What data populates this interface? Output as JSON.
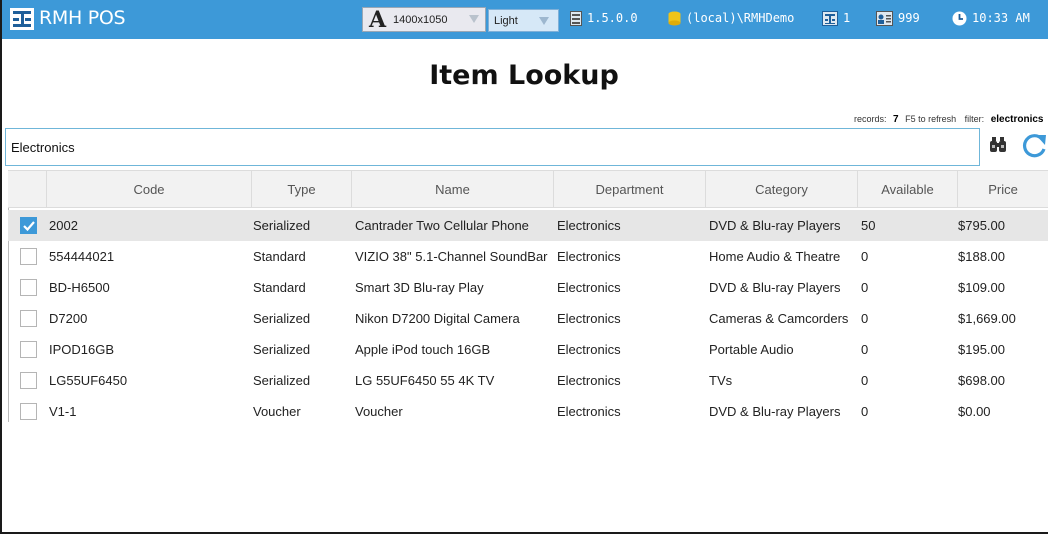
{
  "app": {
    "title": "RMH POS"
  },
  "toolbar": {
    "resolution": "1400x1050",
    "theme": "Light",
    "version": "1.5.0.0",
    "database": "(local)\\RMHDemo",
    "register": "1",
    "cashier": "999",
    "time": "10:33 AM"
  },
  "page": {
    "title": "Item Lookup"
  },
  "status": {
    "records_label": "records:",
    "records_count": "7",
    "refresh_hint": "F5 to refresh",
    "filter_label": "filter:",
    "filter_value": "electronics"
  },
  "search": {
    "value": "Electronics"
  },
  "table": {
    "columns": [
      "Code",
      "Type",
      "Name",
      "Department",
      "Category",
      "Available",
      "Price"
    ],
    "rows": [
      {
        "checked": true,
        "code": "2002",
        "type": "Serialized",
        "name": "Cantrader Two Cellular Phone",
        "department": "Electronics",
        "category": "DVD & Blu-ray Players",
        "available": "50",
        "price": "$795.00"
      },
      {
        "checked": false,
        "code": "554444021",
        "type": "Standard",
        "name": "VIZIO 38\" 5.1-Channel SoundBar",
        "department": "Electronics",
        "category": "Home Audio & Theatre",
        "available": "0",
        "price": "$188.00"
      },
      {
        "checked": false,
        "code": "BD-H6500",
        "type": "Standard",
        "name": "Smart 3D Blu-ray Play",
        "department": "Electronics",
        "category": "DVD & Blu-ray Players",
        "available": "0",
        "price": "$109.00"
      },
      {
        "checked": false,
        "code": "D7200",
        "type": "Serialized",
        "name": "Nikon D7200 Digital Camera",
        "department": "Electronics",
        "category": "Cameras & Camcorders",
        "available": "0",
        "price": "$1,669.00"
      },
      {
        "checked": false,
        "code": "IPOD16GB",
        "type": "Serialized",
        "name": "Apple iPod touch 16GB",
        "department": "Electronics",
        "category": "Portable Audio",
        "available": "0",
        "price": "$195.00"
      },
      {
        "checked": false,
        "code": "LG55UF6450",
        "type": "Serialized",
        "name": "LG 55UF6450 55 4K TV",
        "department": "Electronics",
        "category": "TVs",
        "available": "0",
        "price": "$698.00"
      },
      {
        "checked": false,
        "code": "V1-1",
        "type": "Voucher",
        "name": "Voucher",
        "department": "Electronics",
        "category": "DVD & Blu-ray Players",
        "available": "0",
        "price": "$0.00"
      }
    ]
  },
  "icons": {
    "logo": "rmh-logo-icon",
    "resolution": "font-size-icon",
    "version": "server-icon",
    "database": "database-icon",
    "register": "register-icon",
    "cashier": "cashier-icon",
    "clock": "clock-icon",
    "find": "binoculars-icon",
    "refresh": "refresh-icon",
    "check": "checkmark-icon"
  },
  "colors": {
    "topbar": "#3d99d8",
    "selection": "#e6e6e6",
    "checkbox_checked": "#3d99d8",
    "database_icon": "#f0c419"
  }
}
